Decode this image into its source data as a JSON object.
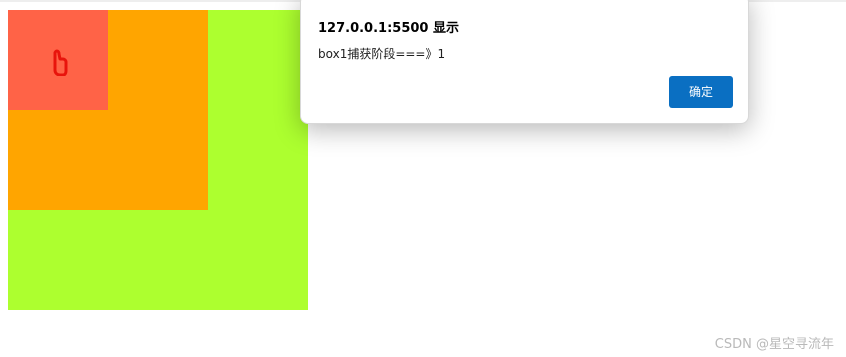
{
  "dialog": {
    "title": "127.0.0.1:5500 显示",
    "message": "box1捕获阶段===》1",
    "ok_label": "确定"
  },
  "boxes": {
    "outer_color": "#adff2f",
    "middle_color": "#ffa500",
    "inner_color": "#ff6347"
  },
  "cursor": {
    "icon": "hand-pointer-icon"
  },
  "watermark": {
    "text": "CSDN @星空寻流年"
  }
}
